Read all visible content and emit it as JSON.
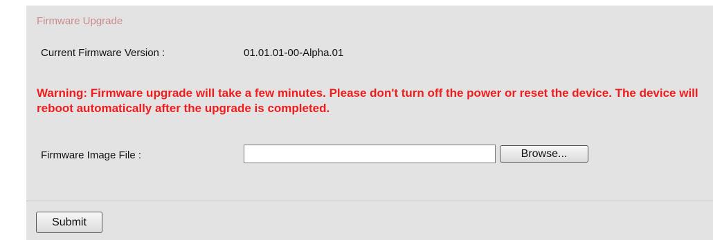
{
  "section": {
    "title": "Firmware Upgrade"
  },
  "version": {
    "label": "Current Firmware Version :",
    "value": "01.01.01-00-Alpha.01"
  },
  "warning": {
    "text": "Warning: Firmware upgrade will take a few minutes. Please don't turn off the power or reset the device. The device will reboot automatically after the upgrade is completed."
  },
  "file": {
    "label": "Firmware Image File :",
    "value": "",
    "browse_label": "Browse..."
  },
  "actions": {
    "submit_label": "Submit"
  },
  "colors": {
    "panel_bg": "#e3e3e3",
    "title": "#c88b8b",
    "warning": "#ee1c1c"
  }
}
